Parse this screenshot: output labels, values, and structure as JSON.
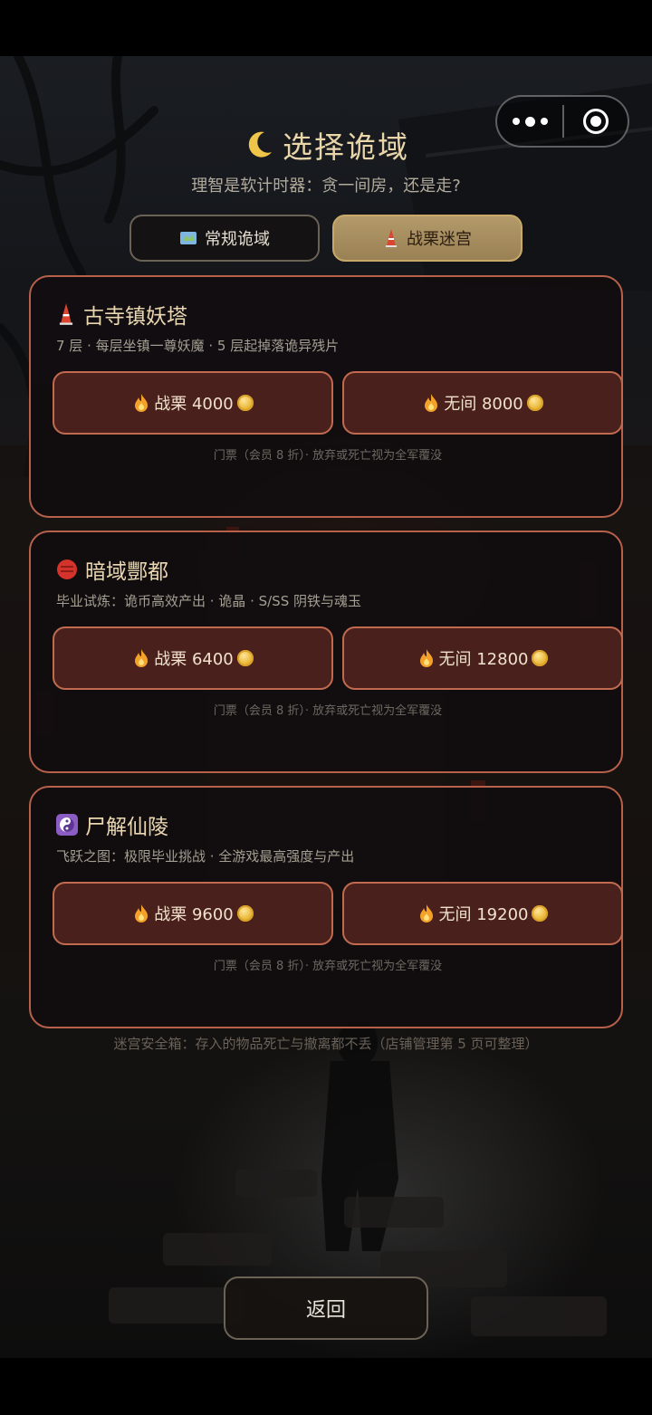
{
  "header": {
    "title": "选择诡域",
    "subtitle": "理智是软计时器：贪一间房，还是走?"
  },
  "capsule": {
    "more_icon": "more-dots-icon",
    "close_icon": "close-target-icon"
  },
  "tabs": [
    {
      "label": "常规诡域",
      "icon": "map-icon",
      "active": false
    },
    {
      "label": "战栗迷宫",
      "icon": "tower-icon",
      "active": true
    }
  ],
  "cards": [
    {
      "name": "古寺镇妖塔",
      "icon": "tower-icon",
      "desc": "7 层 · 每层坐镇一尊妖魔 · 5 层起掉落诡异残片",
      "btn_a": "战栗 4000",
      "btn_b": "无间 8000",
      "note": "门票（会员 8 折）· 放弃或死亡视为全军覆没"
    },
    {
      "name": "暗域酆都",
      "icon": "red-orb-icon",
      "desc": "毕业试炼：诡币高效产出 · 诡晶 · S/SS 阴铁与魂玉",
      "btn_a": "战栗 6400",
      "btn_b": "无间 12800",
      "note": "门票（会员 8 折）· 放弃或死亡视为全军覆没"
    },
    {
      "name": "尸解仙陵",
      "icon": "yin-yang-icon",
      "desc": "飞跃之图：极限毕业挑战 · 全游戏最高强度与产出",
      "btn_a": "战栗 9600",
      "btn_b": "无间 19200",
      "note": "门票（会员 8 折）· 放弃或死亡视为全军覆没"
    }
  ],
  "safe_note": "迷宫安全箱：存入的物品死亡与撤离都不丢（店铺管理第 5 页可整理）",
  "back_label": "返回",
  "colors": {
    "card_border": "#b8614a",
    "button_bg": "#4a201c",
    "gold_text": "#e8d5a8",
    "active_tab": "#b39a6a"
  }
}
